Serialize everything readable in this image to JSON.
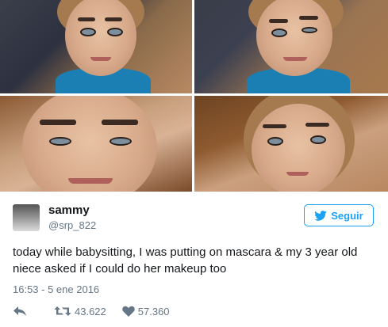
{
  "user": {
    "name": "sammy",
    "handle": "@srp_822"
  },
  "follow_button": {
    "label": "Seguir",
    "icon": "twitter-bird-icon"
  },
  "tweet": {
    "text": "today while babysitting, I was putting on mascara & my 3 year old niece asked if I could do her makeup too",
    "timestamp": "16:53 - 5 ene 2016"
  },
  "actions": {
    "reply_icon": "reply-icon",
    "retweet_icon": "retweet-icon",
    "retweet_count": "43.622",
    "like_icon": "heart-icon",
    "like_count": "57.360"
  },
  "colors": {
    "accent": "#1da1f2",
    "secondary_text": "#657786",
    "primary_text": "#14171a"
  }
}
